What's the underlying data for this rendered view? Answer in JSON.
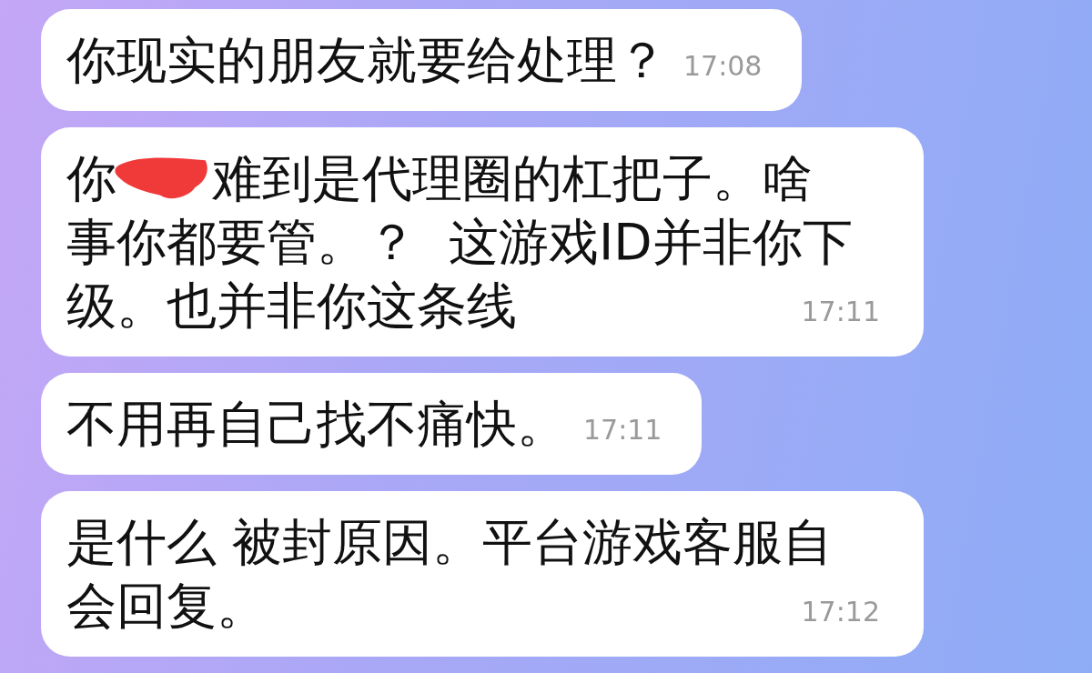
{
  "messages": [
    {
      "lines": [
        [
          {
            "kind": "text",
            "text": "你现实的朋友就要给处理？"
          }
        ]
      ],
      "time": "17:08"
    },
    {
      "lines": [
        [
          {
            "kind": "text",
            "text": "你"
          },
          {
            "kind": "redacted"
          },
          {
            "kind": "text",
            "text": "难到是代理圈的杠把子。啥"
          }
        ],
        [
          {
            "kind": "text",
            "text": "事你都要管。？  这游戏ID并非你下"
          }
        ],
        [
          {
            "kind": "text",
            "text": "级。也并非你这条线"
          }
        ]
      ],
      "time": "17:11"
    },
    {
      "lines": [
        [
          {
            "kind": "text",
            "text": "不用再自己找不痛快。"
          }
        ]
      ],
      "time": "17:11"
    },
    {
      "lines": [
        [
          {
            "kind": "text",
            "text": "是什么 被封原因。平台游戏客服自"
          }
        ],
        [
          {
            "kind": "text",
            "text": "会回复。"
          }
        ]
      ],
      "time": "17:12"
    }
  ]
}
